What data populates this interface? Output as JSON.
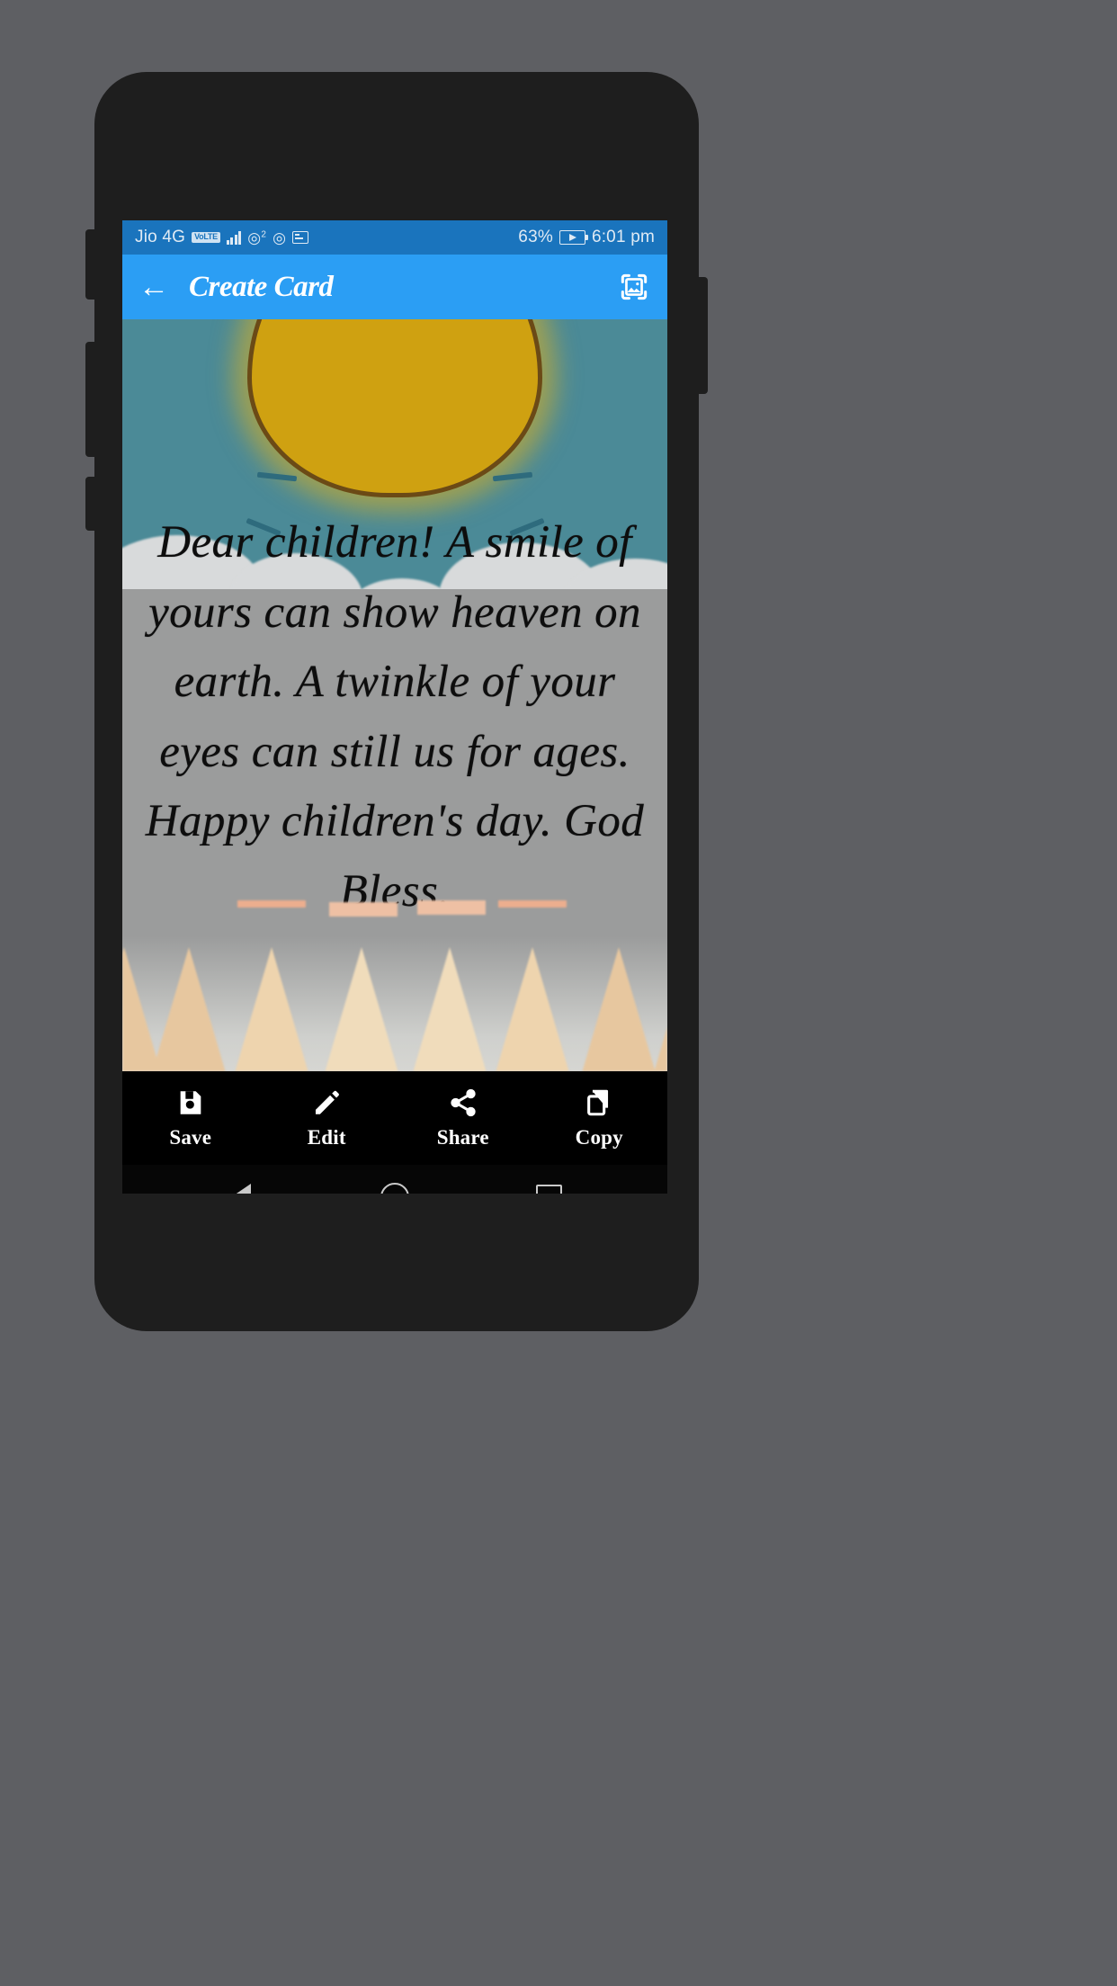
{
  "status_bar": {
    "carrier": "Jio 4G",
    "network_badge": "VoLTE",
    "signal_icon": "signal-bars-icon",
    "sim_icon": "sim-2-signal-icon",
    "sim_superscript": "2",
    "sim2_icon": "sim-signal-icon",
    "sd_card_icon": "sd-card-icon",
    "battery_percent": "63%",
    "battery_icon": "battery-charging-icon",
    "time": "6:01 pm"
  },
  "app_bar": {
    "back_icon": "back-arrow-icon",
    "title": "Create Card",
    "action_icon": "pick-image-icon",
    "background_color": "#2b9ef4"
  },
  "card": {
    "message": "Dear children! A smile of yours can show heaven on earth. A twinkle of your eyes can still us for ages. Happy children's day. God Bless.",
    "sky_color": "#4b8a97",
    "sun_color": "#cfa111",
    "sun_outline_color": "#6b4a16",
    "body_color": "#9b9c9c",
    "text_color": "#0d0d0d",
    "pencil_tip_colors": [
      "#e08020",
      "#3f8a2e",
      "#d8c41b",
      "#7a4a1a",
      "#d6305a",
      "#d8c41b",
      "#3f8a2e",
      "#e08020"
    ]
  },
  "action_bar": {
    "items": [
      {
        "label": "Save",
        "icon": "save-floppy-icon"
      },
      {
        "label": "Edit",
        "icon": "pencil-edit-icon"
      },
      {
        "label": "Share",
        "icon": "share-nodes-icon"
      },
      {
        "label": "Copy",
        "icon": "copy-duplicate-icon"
      }
    ]
  },
  "nav_bar": {
    "back": "android-back-icon",
    "home": "android-home-icon",
    "recents": "android-recents-icon"
  }
}
